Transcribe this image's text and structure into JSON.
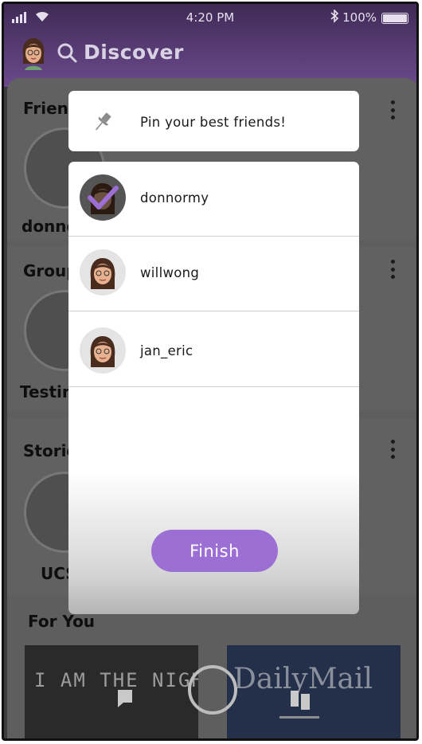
{
  "status_bar": {
    "time": "4:20 PM",
    "battery": "100%"
  },
  "header": {
    "title": "Discover",
    "avatar_icon": "bitmoji-avatar-icon",
    "search_icon": "search-icon"
  },
  "background": {
    "sections": [
      {
        "title": "Frien",
        "label": "donno"
      },
      {
        "title": "Group",
        "label": "Testin"
      },
      {
        "title": "Storie",
        "label": "UCS"
      }
    ],
    "for_you_title": "For You",
    "cards": [
      {
        "text": "I AM THE NIGHT"
      },
      {
        "text": "DailyMail"
      }
    ]
  },
  "modal": {
    "pin_text": "Pin your best friends!",
    "pin_icon": "pin-icon",
    "friends": [
      {
        "username": "donnormy",
        "selected": true
      },
      {
        "username": "willwong",
        "selected": false
      },
      {
        "username": "jan_eric",
        "selected": false
      }
    ],
    "finish_label": "Finish"
  },
  "colors": {
    "accent": "#9b6fd3",
    "header": "#6b4a8c"
  }
}
